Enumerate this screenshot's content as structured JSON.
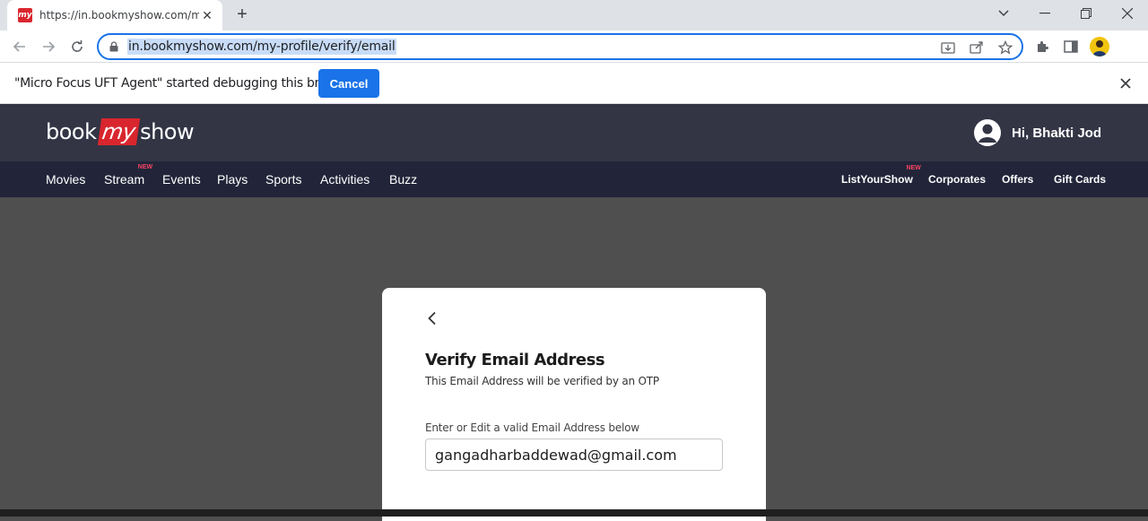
{
  "browser": {
    "tab_title": "https://in.bookmyshow.com/my-profile/verify/email",
    "tab_favicon_text": "my",
    "url": "in.bookmyshow.com/my-profile/verify/email"
  },
  "infobar": {
    "message": "\"Micro Focus UFT Agent\" started debugging this browser",
    "cancel_label": "Cancel"
  },
  "site": {
    "logo": {
      "book": "book",
      "my": "my",
      "show": "show"
    },
    "greeting": "Hi, Bhakti Jod",
    "nav_left": [
      {
        "label": "Movies"
      },
      {
        "label": "Stream",
        "badge": "NEW"
      },
      {
        "label": "Events"
      },
      {
        "label": "Plays"
      },
      {
        "label": "Sports"
      },
      {
        "label": "Activities"
      },
      {
        "label": "Buzz"
      }
    ],
    "nav_right": [
      {
        "label": "ListYourShow",
        "badge": "NEW"
      },
      {
        "label": "Corporates"
      },
      {
        "label": "Offers"
      },
      {
        "label": "Gift Cards"
      }
    ]
  },
  "modal": {
    "title": "Verify Email Address",
    "subtitle": "This Email Address will be verified by an OTP",
    "field_label": "Enter or Edit a valid Email Address below",
    "email_value": "gangadharbaddewad@gmail.com"
  },
  "colors": {
    "brand_red": "#d9262e",
    "header_bg": "#333545",
    "nav_bg": "#222539",
    "overlay_bg": "#4f4f4f",
    "accent_blue": "#1a73e8",
    "new_badge": "#f84464"
  }
}
